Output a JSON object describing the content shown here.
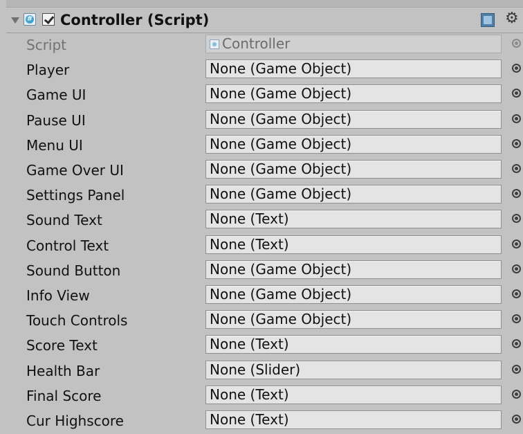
{
  "component": {
    "title": "Controller (Script)",
    "enabled": true,
    "icons": [
      "foldout-arrow",
      "csharp-script-icon",
      "enable-checkbox",
      "help-icon",
      "gear-icon"
    ]
  },
  "fields": [
    {
      "label": "Script",
      "value": "Controller",
      "disabled": true
    },
    {
      "label": "Player",
      "value": "None (Game Object)"
    },
    {
      "label": "Game UI",
      "value": "None (Game Object)"
    },
    {
      "label": "Pause UI",
      "value": "None (Game Object)"
    },
    {
      "label": "Menu UI",
      "value": "None (Game Object)"
    },
    {
      "label": "Game Over UI",
      "value": "None (Game Object)"
    },
    {
      "label": "Settings Panel",
      "value": "None (Game Object)"
    },
    {
      "label": "Sound Text",
      "value": "None (Text)"
    },
    {
      "label": "Control Text",
      "value": "None (Text)"
    },
    {
      "label": "Sound Button",
      "value": "None (Game Object)"
    },
    {
      "label": "Info View",
      "value": "None (Game Object)"
    },
    {
      "label": "Touch Controls",
      "value": "None (Game Object)"
    },
    {
      "label": "Score Text",
      "value": "None (Text)"
    },
    {
      "label": "Health Bar",
      "value": "None (Slider)"
    },
    {
      "label": "Final Score",
      "value": "None (Text)"
    },
    {
      "label": "Cur Highscore",
      "value": "None (Text)"
    }
  ]
}
